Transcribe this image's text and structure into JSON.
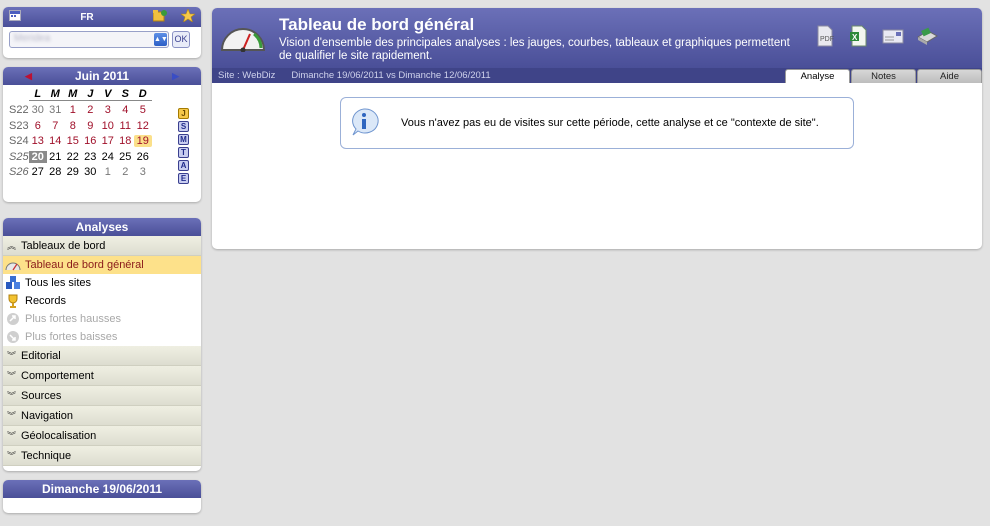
{
  "top": {
    "lang": "FR",
    "site_value": "Meridea",
    "ok_label": "OK"
  },
  "calendar": {
    "month": "Juin 2011",
    "days_header": [
      "L",
      "M",
      "M",
      "J",
      "V",
      "S",
      "D"
    ],
    "weeks": [
      {
        "wk": "S22",
        "days": [
          "30",
          "31",
          "1",
          "2",
          "3",
          "4",
          "5"
        ]
      },
      {
        "wk": "S23",
        "days": [
          "6",
          "7",
          "8",
          "9",
          "10",
          "11",
          "12"
        ]
      },
      {
        "wk": "S24",
        "days": [
          "13",
          "14",
          "15",
          "16",
          "17",
          "18",
          "19"
        ]
      },
      {
        "wk": "S25",
        "days": [
          "20",
          "21",
          "22",
          "23",
          "24",
          "25",
          "26"
        ]
      },
      {
        "wk": "S26",
        "days": [
          "27",
          "28",
          "29",
          "30",
          "1",
          "2",
          "3"
        ]
      }
    ],
    "period_buttons": [
      "J",
      "S",
      "M",
      "T",
      "A",
      "E"
    ]
  },
  "analyses": {
    "title": "Analyses",
    "open_section": "Tableaux de bord",
    "items": [
      {
        "label": "Tableau de bord général"
      },
      {
        "label": "Tous les sites"
      },
      {
        "label": "Records"
      },
      {
        "label": "Plus fortes hausses"
      },
      {
        "label": "Plus fortes baisses"
      }
    ],
    "sections": [
      "Editorial",
      "Comportement",
      "Sources",
      "Navigation",
      "Géolocalisation",
      "Technique"
    ]
  },
  "bottom_date": "Dimanche 19/06/2011",
  "main": {
    "title": "Tableau de bord général",
    "subtitle": "Vision d'ensemble des principales analyses : les jauges, courbes, tableaux et graphiques permettent de qualifier le site rapidement.",
    "site_label": "Site : WebDiz",
    "compare_label": "Dimanche 19/06/2011 vs Dimanche 12/06/2011",
    "tabs": [
      "Analyse",
      "Notes",
      "Aide"
    ],
    "message": "Vous n'avez pas eu de visites sur cette période, cette analyse et ce \"contexte de site\"."
  },
  "colors": {
    "header": "#4a4f98",
    "selected": "#fde18a",
    "accent_red": "#a0102a"
  }
}
